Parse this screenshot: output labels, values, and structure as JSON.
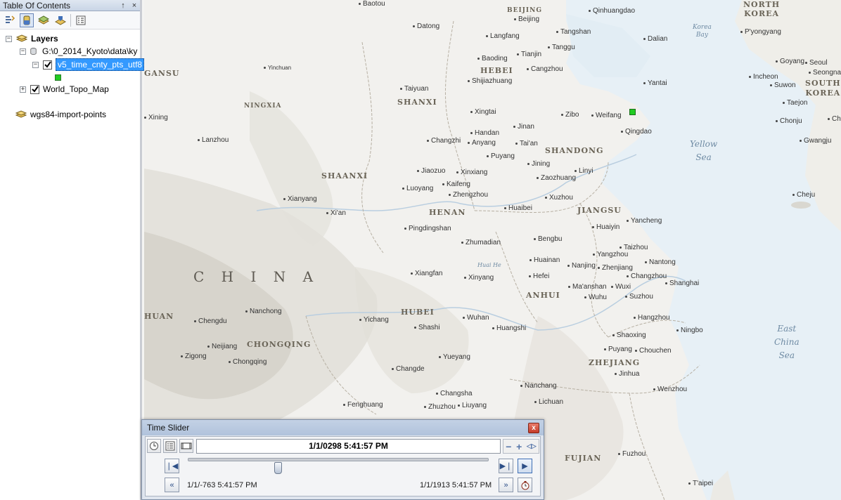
{
  "toc": {
    "title": "Table Of Contents",
    "pin_glyph": "↑",
    "close_glyph": "×",
    "toolbar": [
      "list-by-drawing-order-icon",
      "list-by-source-icon",
      "list-by-visibility-icon",
      "list-by-selection-icon",
      "options-icon"
    ],
    "layers_group": "Layers",
    "source_path": "G:\\0_2014_Kyoto\\data\\ky",
    "selected_layer": "v5_time_cnty_pts_utf8",
    "legend_color": "#22cc22",
    "basemap_layer": "World_Topo_Map",
    "standalone_table": "wgs84-import-points"
  },
  "map": {
    "countries": [
      "C H I N A"
    ],
    "korea_north": "NORTH\nKOREA",
    "korea_south": "SOUTH\nKOREA",
    "seas": [
      "Yellow\nSea",
      "East\nChina\nSea",
      "Korea\nBay"
    ],
    "regions": [
      "SHAANXI",
      "SHANXI",
      "HEBEI",
      "SHANDONG",
      "HENAN",
      "JIANGSU",
      "ANHUI",
      "HUBEI",
      "CHONGQING",
      "ZHEJIANG",
      "FUJIAN",
      "NINGXIA",
      "GANSU",
      "BEIJING"
    ],
    "region_fragments": [
      "SICHUAN",
      "HUAN",
      "Yinchuan",
      "Huai He"
    ],
    "cities": [
      "Baotou",
      "Datong",
      "Beijing",
      "Langfang",
      "Tianjin",
      "Tangshan",
      "Qinhuangdao",
      "Tanggu",
      "Dalian",
      "Baoding",
      "Cangzhou",
      "Shijiazhuang",
      "Taiyuan",
      "Xingtai",
      "Handan",
      "Anyang",
      "Changzhi",
      "Jinan",
      "Zibo",
      "Weifang",
      "Yantai",
      "Qingdao",
      "Tai'an",
      "Jining",
      "Linyi",
      "Zaozhuang",
      "Xuzhou",
      "Puyang",
      "Jiaozuo",
      "Xinxiang",
      "Kaifeng",
      "Zhengzhou",
      "Luoyang",
      "Xianyang",
      "Xi'an",
      "Lanzhou",
      "Xining",
      "Pingdingshan",
      "Zhumadian",
      "Huaibei",
      "Bengbu",
      "Huaiyin",
      "Yancheng",
      "Taizhou",
      "Yangzhou",
      "Huainan",
      "Nanjing",
      "Zhenjiang",
      "Nantong",
      "Hefei",
      "Changzhou",
      "Ma'anshan",
      "Wuxi",
      "Shanghai",
      "Wuhu",
      "Suzhou",
      "Xiangfan",
      "Xinyang",
      "Nanchong",
      "Chengdu",
      "Yichang",
      "Shashi",
      "Wuhan",
      "Huangshi",
      "Hangzhou",
      "Ningbo",
      "Shaoxing",
      "Neijiang",
      "Zigong",
      "Chongqing",
      "Changde",
      "Yueyang",
      "Puyang",
      "Chouchen",
      "Jinhua",
      "Changsha",
      "Nanchang",
      "Wenzhou",
      "Zhuzhou",
      "Liuyang",
      "Fenghuang",
      "Lichuan",
      "Fuzhou",
      "T'aipei",
      "P'yongyang",
      "Seoul",
      "Incheon",
      "Suwon",
      "Taejon",
      "Chonju",
      "Gwangju",
      "Cheju",
      "Goyang",
      "Seongnam",
      "Chongju"
    ],
    "point_color": "#22cc22"
  },
  "time_slider": {
    "title": "Time Slider",
    "close_glyph": "x",
    "current_time": "1/1/0298 5:41:57 PM",
    "start_time": "1/1/-763 5:41:57 PM",
    "end_time": "1/1/1913 5:41:57 PM",
    "position": 0.3,
    "zoom_out_glyph": "−",
    "zoom_in_glyph": "+",
    "zoom_full_glyph": "◁▷",
    "step_back_glyph": "❘◀",
    "step_forward_glyph": "▶❘",
    "play_glyph": "▶",
    "rewind_glyph": "«",
    "forward_glyph": "»"
  }
}
